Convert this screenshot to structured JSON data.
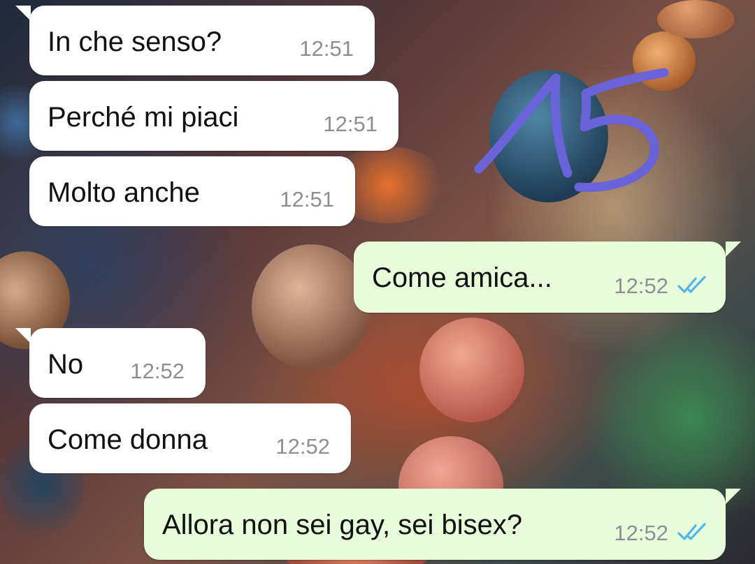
{
  "messages": [
    {
      "direction": "in",
      "text": "In che senso?",
      "time": "12:51"
    },
    {
      "direction": "in",
      "text": "Perché mi piaci",
      "time": "12:51"
    },
    {
      "direction": "in",
      "text": "Molto anche",
      "time": "12:51"
    },
    {
      "direction": "out",
      "text": "Come amica...",
      "time": "12:52",
      "status": "read"
    },
    {
      "direction": "in",
      "text": "No",
      "time": "12:52"
    },
    {
      "direction": "in",
      "text": "Come donna",
      "time": "12:52"
    },
    {
      "direction": "out",
      "text": "Allora non sei gay, sei bisex?",
      "time": "12:52",
      "status": "read"
    }
  ],
  "annotation": {
    "text": "15",
    "color": "#6a62d8"
  },
  "colors": {
    "incoming_bubble": "#ffffff",
    "outgoing_bubble": "#e7fcd9",
    "timestamp": "#8b8f93",
    "read_ticks": "#4fb6ec"
  },
  "icons": {
    "read_receipt": "double-check-icon"
  }
}
